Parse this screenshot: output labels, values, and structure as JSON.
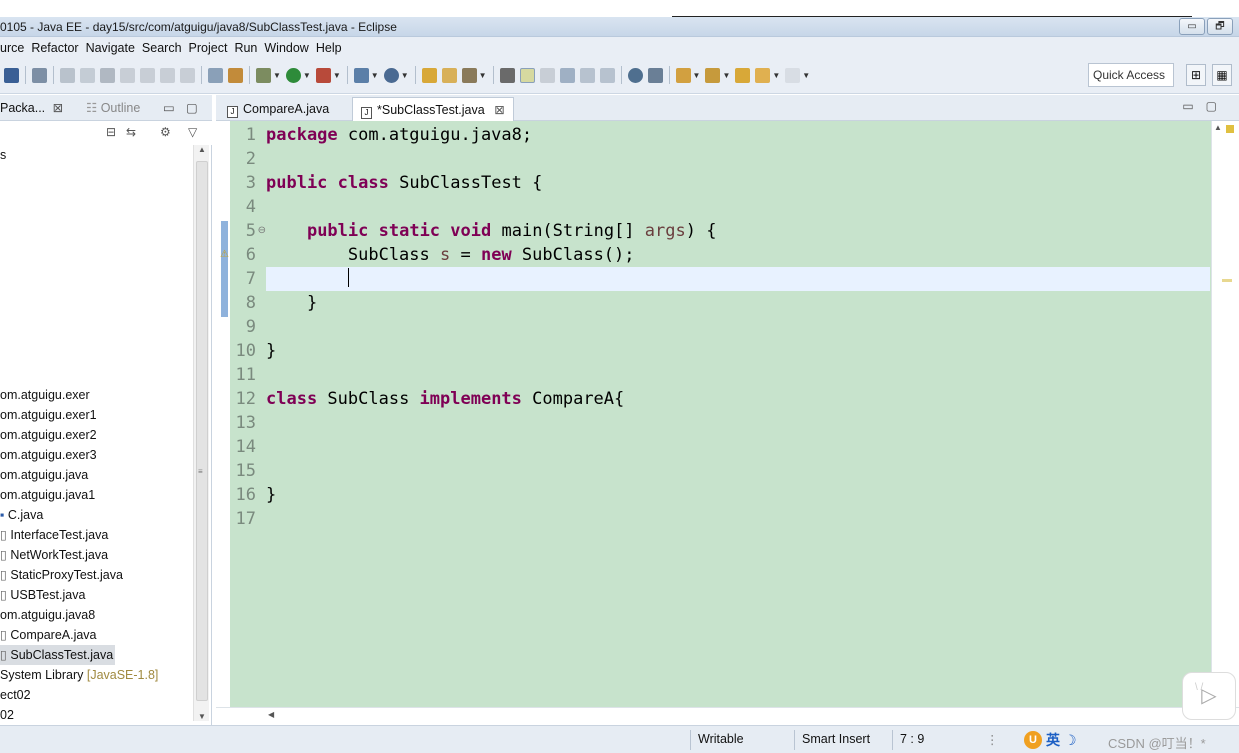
{
  "window": {
    "title": "0105 - Java EE - day15/src/com/atguigu/java8/SubClassTest.java - Eclipse",
    "min_label": "▭",
    "max_label": "🗗"
  },
  "menu": [
    "urce",
    "Refactor",
    "Navigate",
    "Search",
    "Project",
    "Run",
    "Window",
    "Help"
  ],
  "toolbar": {
    "quick_access": "Quick Access"
  },
  "left_panel": {
    "tabs": [
      {
        "label": "Packa...",
        "close": "⊠"
      },
      {
        "label": "Outline"
      }
    ],
    "tree": [
      {
        "label": "s"
      },
      {
        "label": "om.atguigu.exer"
      },
      {
        "label": "om.atguigu.exer1"
      },
      {
        "label": "om.atguigu.exer2"
      },
      {
        "label": "om.atguigu.exer3"
      },
      {
        "label": "om.atguigu.java"
      },
      {
        "label": "om.atguigu.java1"
      },
      {
        "label": "C.java"
      },
      {
        "label": "InterfaceTest.java"
      },
      {
        "label": "NetWorkTest.java"
      },
      {
        "label": "StaticProxyTest.java"
      },
      {
        "label": "USBTest.java"
      },
      {
        "label": "om.atguigu.java8"
      },
      {
        "label": "CompareA.java"
      },
      {
        "label": "SubClassTest.java"
      },
      {
        "label": "System Library",
        "extra": "[JavaSE-1.8]"
      },
      {
        "label": "ect02"
      },
      {
        "label": "02"
      }
    ]
  },
  "editor": {
    "tabs": [
      {
        "label": "CompareA.java",
        "active": false
      },
      {
        "label": "*SubClassTest.java",
        "active": true,
        "close": "⊠"
      }
    ],
    "line_numbers": [
      "1",
      "2",
      "3",
      "4",
      "5",
      "6",
      "7",
      "8",
      "9",
      "10",
      "11",
      "12",
      "13",
      "14",
      "15",
      "16",
      "17"
    ],
    "code": {
      "l1_kw": "package",
      "l1_rest": " com.atguigu.java8;",
      "l3_kw1": "public",
      "l3_kw2": "class",
      "l3_rest": " SubClassTest {",
      "l5_indent": "    ",
      "l5_kw1": "public",
      "l5_kw2": "static",
      "l5_kw3": "void",
      "l5_mid": " main(String[] ",
      "l5_var": "args",
      "l5_end": ") {",
      "l6_indent": "        SubClass ",
      "l6_var": "s",
      "l6_mid": " = ",
      "l6_kw": "new",
      "l6_end": " SubClass();",
      "l7_indent": "        ",
      "l8": "    }",
      "l10": "}",
      "l12_kw1": "class",
      "l12_mid": " SubClass ",
      "l12_kw2": "implements",
      "l12_end": " CompareA{",
      "l16": "}"
    }
  },
  "statusbar": {
    "writable": "Writable",
    "insert_mode": "Smart Insert",
    "position": "7 : 9",
    "ime_lang": "英",
    "watermark": "CSDN @叮当！*"
  },
  "colors": {
    "editor_bg": "#c7e3cc",
    "keyword": "#7f0055",
    "current_line": "#e8f2ff"
  }
}
